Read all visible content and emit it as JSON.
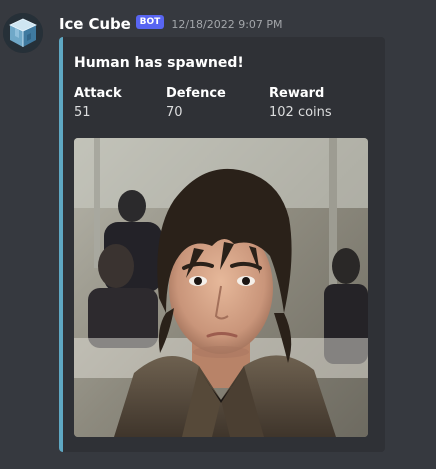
{
  "message": {
    "author": {
      "name": "Ice Cube",
      "bot_tag": "BOT",
      "avatar_icon": "ice-cube-avatar-icon"
    },
    "timestamp": "12/18/2022 9:07 PM",
    "embed": {
      "accent_color": "#5fa8c3",
      "title": "Human has spawned!",
      "fields": [
        {
          "name": "Attack",
          "value": "51"
        },
        {
          "name": "Defence",
          "value": "70"
        },
        {
          "name": "Reward",
          "value": "102 coins"
        }
      ],
      "image_icon": "photo-young-man-portrait"
    }
  }
}
